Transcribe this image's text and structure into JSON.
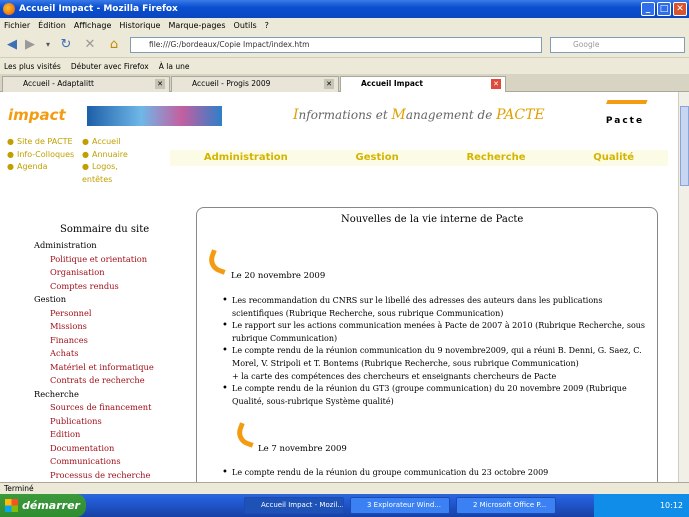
{
  "window": {
    "title": "Accueil Impact - Mozilla Firefox",
    "minimize": "_",
    "maximize": "□",
    "close": "✕"
  },
  "menu": [
    "Fichier",
    "Édition",
    "Affichage",
    "Historique",
    "Marque-pages",
    "Outils",
    "?"
  ],
  "nav": {
    "url": "file:///G:/bordeaux/Copie Impact/index.htm",
    "search_placeholder": "Google",
    "back_icon": "back-arrow-icon",
    "reload_icon": "reload-icon"
  },
  "bookmarks": [
    "Les plus visités",
    "Débuter avec Firefox",
    "À la une"
  ],
  "tabs": [
    {
      "label": "Accueil - Adaptalitt"
    },
    {
      "label": "Accueil - Progis 2009"
    },
    {
      "label": "Accueil Impact"
    }
  ],
  "page": {
    "logo": "impact",
    "header_title_parts": [
      "I",
      "nformations et ",
      "M",
      "anagement de ",
      "PACTE"
    ],
    "pacte_logo": "Pacte",
    "left_links_col1": [
      "Site de PACTE",
      "Info-Colloques",
      "Agenda"
    ],
    "left_links_col2": [
      "Accueil",
      "Annuaire",
      "Logos,",
      "entêtes"
    ],
    "main_nav": [
      "Administration",
      "Gestion",
      "Recherche",
      "Qualité"
    ],
    "sommaire_title": "Sommaire du site",
    "sommaire": [
      {
        "section": "Administration",
        "items": [
          "Politique et orientation",
          "Organisation",
          "Comptes rendus"
        ]
      },
      {
        "section": "Gestion",
        "items": [
          "Personnel",
          "Missions",
          "Finances",
          "Achats",
          "Matériel et informatique",
          "Contrats de recherche"
        ]
      },
      {
        "section": "Recherche",
        "items": [
          "Sources de financement",
          "Publications",
          "Edition",
          "Documentation",
          "Communications",
          "Processus de recherche"
        ]
      }
    ],
    "news_title": "Nouvelles de la vie interne de Pacte",
    "date1": "Le 20 novembre 2009",
    "news1": [
      "Les recommandation du CNRS sur le libellé des adresses des auteurs dans les publications scientifiques (Rubrique Recherche, sous rubrique Communication)",
      "Le rapport sur les actions communication menées à Pacte de 2007 à 2010 (Rubrique Recherche, sous rubrique Communication)",
      "Le compte rendu de la réunion communication du 9 novembre2009, qui a réuni B. Denni, G. Saez, C. Morel, V. Stripoli et T. Bontems (Rubrique Recherche, sous rubrique Communication)",
      "Le compte rendu de la réunion du GT3 (groupe communication) du 20 novembre 2009 (Rubrique Qualité, sous-rubrique Système qualité)"
    ],
    "news1_extra": "+ la carte des compétences des chercheurs et enseignants chercheurs de Pacte",
    "date2": "Le 7 novembre 2009",
    "news2": [
      "Le compte rendu de la réunion du groupe communication du 23 octobre 2009"
    ]
  },
  "status": "Terminé",
  "taskbar": {
    "start": "démarrer",
    "items": [
      "Accueil Impact - Mozil...",
      "3 Explorateur Wind...",
      "2 Microsoft Office P..."
    ],
    "clock": "10:12"
  }
}
